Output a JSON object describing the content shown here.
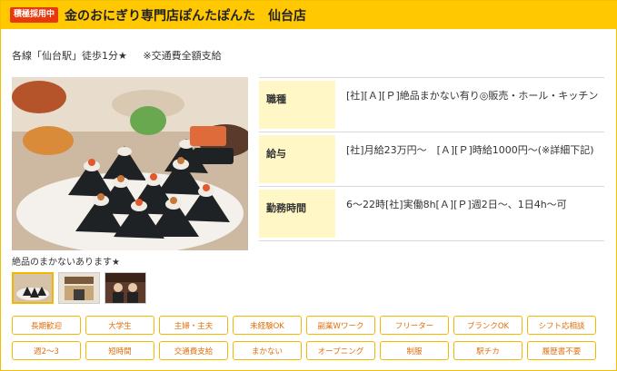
{
  "header": {
    "badge": "積極採用中",
    "title": "金のおにぎり専門店ぽんたぽんた　仙台店"
  },
  "access": {
    "station": "各線「仙台駅」徒歩1分★",
    "transport": "※交通費全額支給"
  },
  "gallery": {
    "caption": "絶品のまかないあります★",
    "thumbnails": 3,
    "selected_index": 0
  },
  "details": [
    {
      "label": "職種",
      "value": "[社][Ａ][Ｐ]絶品まかない有り◎販売・ホール・キッチン"
    },
    {
      "label": "給与",
      "value": "[社]月給23万円～　[Ａ][Ｐ]時給1000円～(※詳細下記)"
    },
    {
      "label": "勤務時間",
      "value": "6～22時[社]実働8h[Ａ][Ｐ]週2日～、1日4h～可"
    }
  ],
  "tags": [
    "長期歓迎",
    "大学生",
    "主婦・主夫",
    "未経験OK",
    "副業Wワーク",
    "フリーター",
    "ブランクOK",
    "シフト応相談",
    "週2～3",
    "短時間",
    "交通費支給",
    "まかない",
    "オープニング",
    "制服",
    "駅チカ",
    "履歴書不要"
  ],
  "colors": {
    "header_bg": "#ffc800",
    "badge_bg": "#e8380d",
    "label_bg": "#fff7c6",
    "tag_border": "#f5b800",
    "tag_text": "#e0700a"
  }
}
